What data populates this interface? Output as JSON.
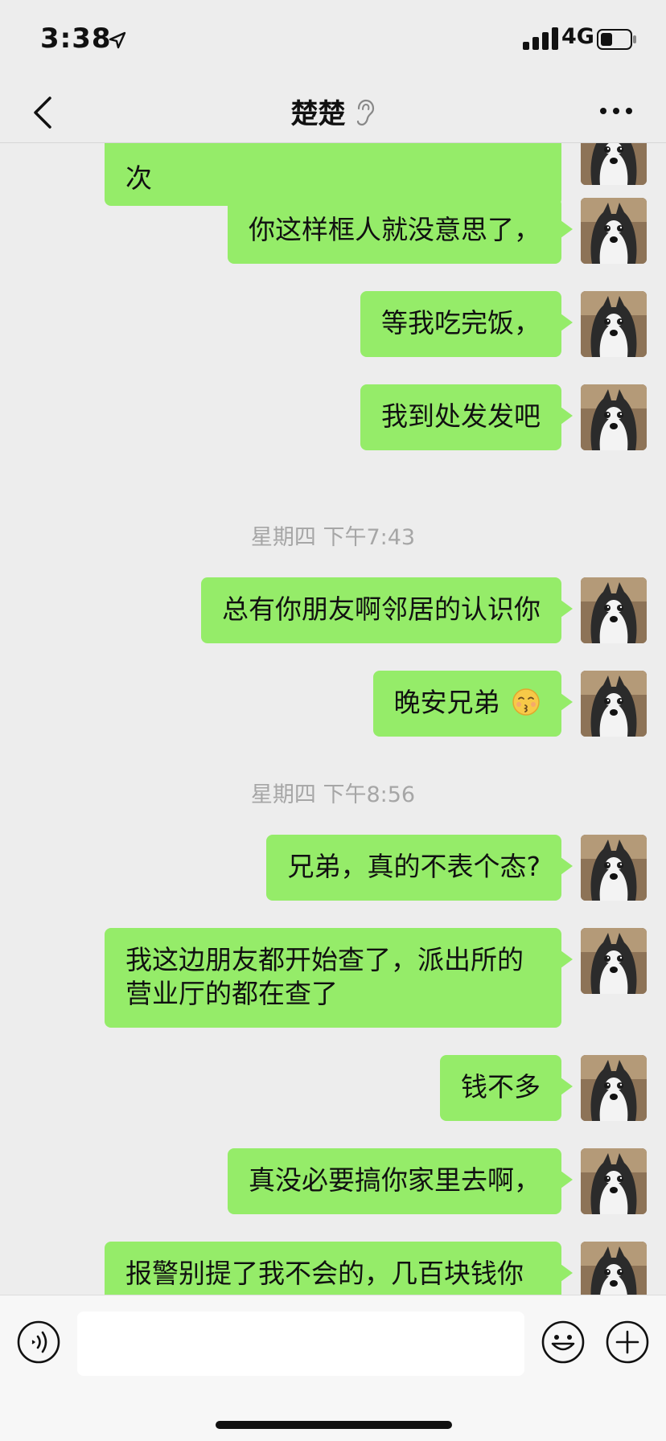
{
  "status_bar": {
    "time": "3:38",
    "network": "4G"
  },
  "nav": {
    "title": "楚楚"
  },
  "messages": [
    {
      "type": "sent",
      "text": "次"
    },
    {
      "type": "sent",
      "text": "你这样框人就没意思了，"
    },
    {
      "type": "sent",
      "text": "等我吃完饭，"
    },
    {
      "type": "sent",
      "text": "我到处发发吧"
    },
    {
      "type": "time",
      "text": "星期四 下午7:43"
    },
    {
      "type": "sent",
      "text": "总有你朋友啊邻居的认识你"
    },
    {
      "type": "sent",
      "text": "晚安兄弟",
      "emoji": "kissing-face-icon"
    },
    {
      "type": "time",
      "text": "星期四 下午8:56"
    },
    {
      "type": "sent",
      "text": "兄弟，真的不表个态?"
    },
    {
      "type": "sent",
      "line1": "我这边朋友都开始查了，派出所的",
      "line2": "营业厅的都在查了"
    },
    {
      "type": "sent",
      "text": "钱不多"
    },
    {
      "type": "sent",
      "text": "真没必要搞你家里去啊，"
    },
    {
      "type": "sent",
      "text": "报警别提了我不会的，几百块钱你"
    }
  ],
  "input": {
    "placeholder": ""
  },
  "colors": {
    "bubble": "#95ec69",
    "background": "#ededed",
    "timestamp": "#a6a6a6"
  },
  "icons": [
    "location-arrow-icon",
    "signal-icon",
    "battery-icon",
    "back-chevron-icon",
    "ear-icon",
    "more-icon",
    "voice-icon",
    "emoji-icon",
    "plus-icon",
    "kissing-face-icon"
  ]
}
